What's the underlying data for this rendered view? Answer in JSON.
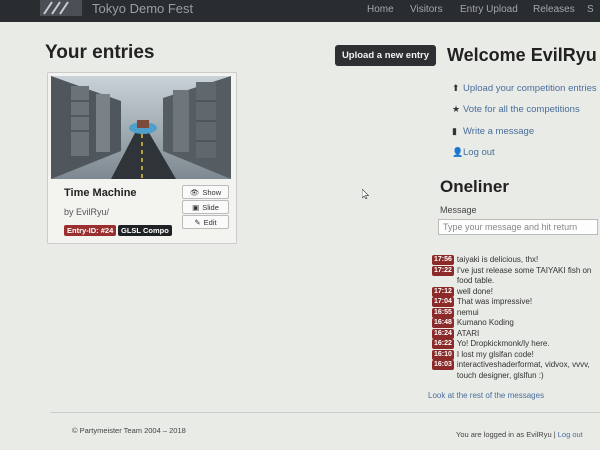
{
  "navbar": {
    "brand": "Tokyo Demo Fest",
    "links": [
      "Home",
      "Visitors",
      "Entry Upload",
      "Releases",
      "S"
    ]
  },
  "entries": {
    "heading": "Your entries",
    "upload_button": "Upload a new entry",
    "card": {
      "title": "Time Machine",
      "author": "by EvilRyu/",
      "entry_id": "Entry-ID: #24",
      "compo": "GLSL Compo",
      "buttons": [
        "Show",
        "Slide",
        "Edit"
      ]
    }
  },
  "welcome": {
    "heading": "Welcome EvilRyu",
    "links": [
      {
        "icon": "upload-icon",
        "label": "Upload your competition entries"
      },
      {
        "icon": "star-icon",
        "label": "Vote for all the competitions"
      },
      {
        "icon": "comment-icon",
        "label": "Write a message"
      },
      {
        "icon": "user-icon",
        "label": "Log out"
      }
    ]
  },
  "oneliner": {
    "heading": "Oneliner",
    "message_label": "Message",
    "placeholder": "Type your message and hit return",
    "messages": [
      {
        "time": "17:56",
        "text": "taiyaki is delicious, thx!"
      },
      {
        "time": "17:22",
        "text": "I've just release some TAIYAKI fish on food table."
      },
      {
        "time": "17:12",
        "text": "well done!"
      },
      {
        "time": "17:04",
        "text": "That was impressive!"
      },
      {
        "time": "16:55",
        "text": "nemui"
      },
      {
        "time": "16:48",
        "text": "Kumano Koding"
      },
      {
        "time": "16:24",
        "text": "ATARI"
      },
      {
        "time": "16:22",
        "text": "Yo! Dropkickmonk/ly here."
      },
      {
        "time": "16:10",
        "text": "I lost my glslfan code!"
      },
      {
        "time": "16:03",
        "text": "interactiveshaderformat, vidvox, vvvv, touch designer, glslfun :)"
      }
    ],
    "more_link": "Look at the rest of the messages"
  },
  "footer": {
    "copyright": "© Partymeister Team 2004 – 2018",
    "logged_in": "You are logged in as EvilRyu",
    "separator": "|",
    "logout": "Log out"
  },
  "colors": {
    "navbar": "#2a2d30",
    "background": "#e9ebe6",
    "link": "#4a6d9c",
    "time_badge": "#8c2a2a",
    "entry_id_badge": "#9a2f2f",
    "compo_badge": "#1f2224"
  }
}
